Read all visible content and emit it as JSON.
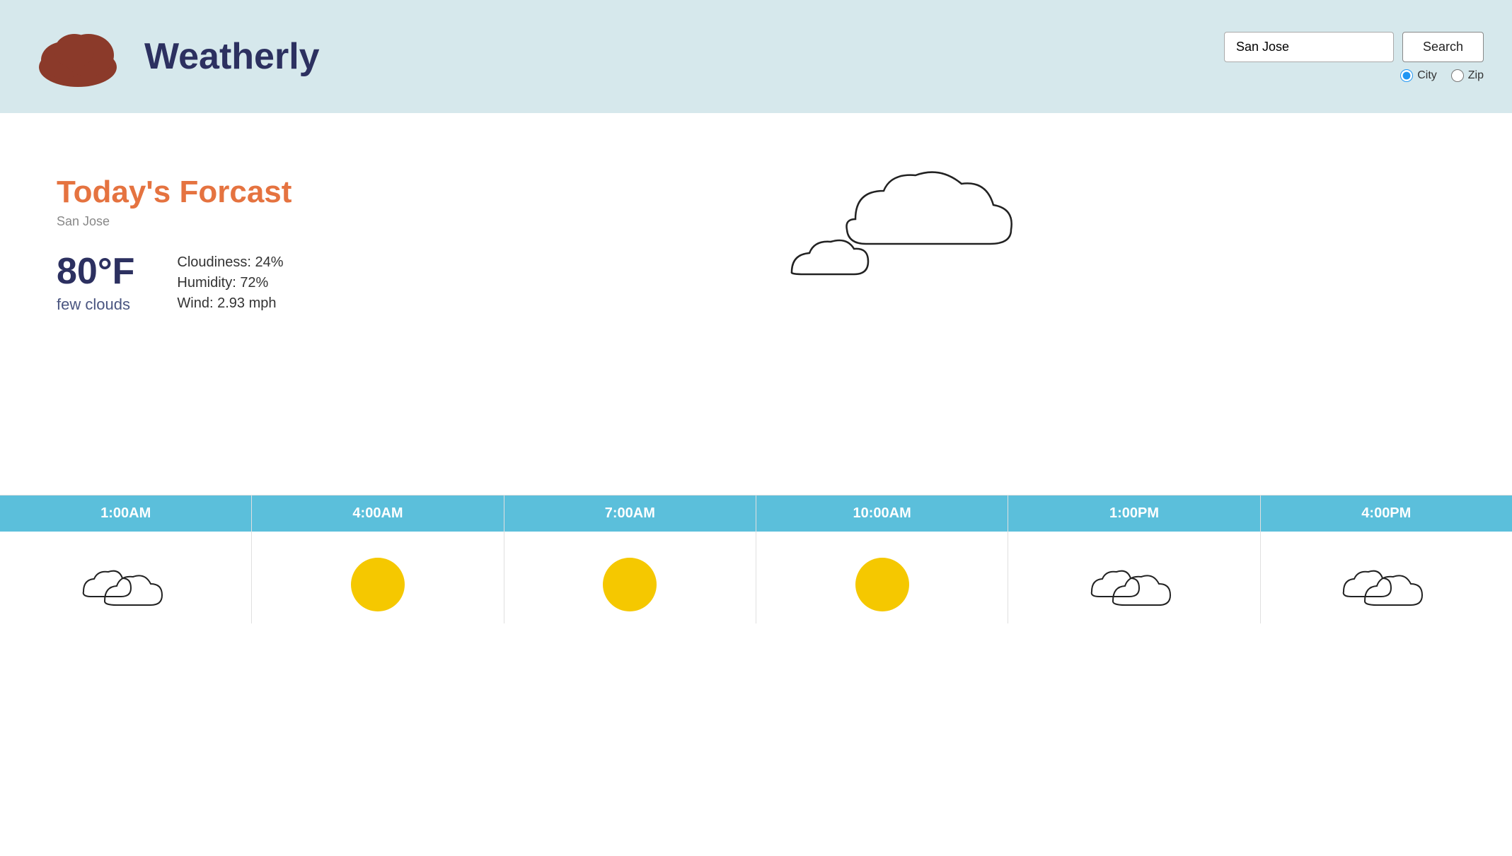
{
  "header": {
    "app_title": "Weatherly",
    "search_value": "San Jose",
    "search_placeholder": "San Jose",
    "search_button_label": "Search",
    "radio_options": [
      {
        "id": "city",
        "label": "City",
        "checked": true
      },
      {
        "id": "zip",
        "label": "Zip",
        "checked": false
      }
    ]
  },
  "forecast": {
    "title": "Today's Forcast",
    "city": "San Jose",
    "temperature": "80°F",
    "condition": "few clouds",
    "cloudiness": "Cloudiness: 24%",
    "humidity": "Humidity: 72%",
    "wind": "Wind: 2.93 mph"
  },
  "hourly": [
    {
      "time": "1:00AM",
      "icon": "clouds"
    },
    {
      "time": "4:00AM",
      "icon": "sun"
    },
    {
      "time": "7:00AM",
      "icon": "sun"
    },
    {
      "time": "10:00AM",
      "icon": "sun"
    },
    {
      "time": "1:00PM",
      "icon": "clouds"
    },
    {
      "time": "4:00PM",
      "icon": "clouds"
    }
  ],
  "colors": {
    "header_bg": "#d6e8ec",
    "title_color": "#2c3060",
    "forecast_title": "#e57340",
    "hour_label_bg": "#5bbfdb"
  }
}
